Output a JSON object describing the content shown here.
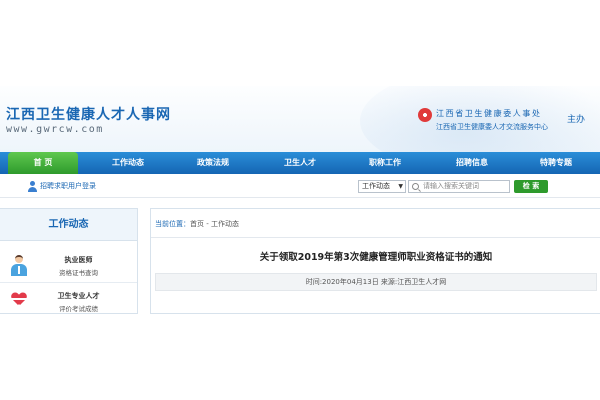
{
  "header": {
    "site_title": "江西卫生健康人才人事网",
    "site_domain": "www.gwrcw.com",
    "sponsor_line1": "江西省卫生健康委人事处",
    "sponsor_line2": "江西省卫生健康委人才交流服务中心",
    "sponsor_tag": "主办"
  },
  "nav": {
    "items": [
      "首 页",
      "工作动态",
      "政策法规",
      "卫生人才",
      "职称工作",
      "招聘信息",
      "特聘专题"
    ]
  },
  "subbar": {
    "login_text": "招聘求职用户登录",
    "search_scope": "工作动态",
    "search_placeholder": "请输入搜索关键词",
    "search_button": "检 索"
  },
  "sidebar": {
    "title": "工作动态",
    "items": [
      {
        "title": "执业医师",
        "subtitle": "资格证书查询",
        "icon": "doctor-icon"
      },
      {
        "title": "卫生专业人才",
        "subtitle": "评价考试成绩",
        "icon": "heart-pulse-icon"
      }
    ]
  },
  "main": {
    "breadcrumb_label": "当前位置：",
    "breadcrumb_path": "首页 - 工作动态",
    "article_title": "关于领取2019年第3次健康管理师职业资格证书的通知",
    "meta": "时间:2020年04月13日  来源:江西卫生人才网"
  },
  "colors": {
    "brand_blue": "#1a67b3",
    "nav_blue": "#1b73c2",
    "active_green": "#2e9a2c"
  }
}
